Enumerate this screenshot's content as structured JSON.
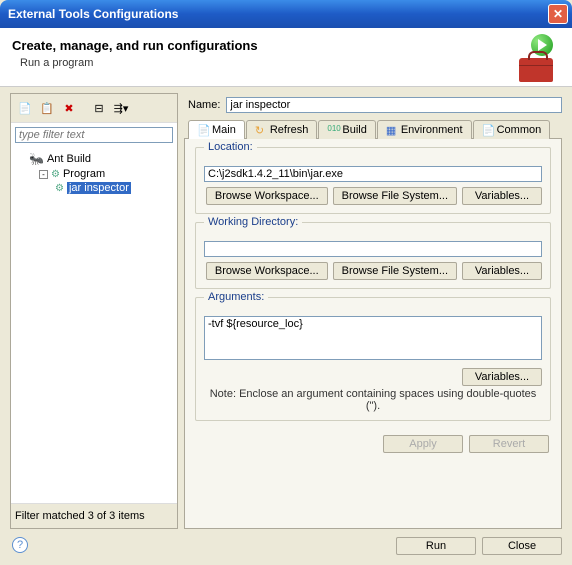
{
  "window": {
    "title": "External Tools Configurations"
  },
  "header": {
    "title": "Create, manage, and run configurations",
    "subtitle": "Run a program"
  },
  "toolbar": {
    "new_tip": "New",
    "duplicate_tip": "Duplicate",
    "delete_tip": "Delete",
    "collapse_tip": "Collapse All",
    "filter_tip": "Filter"
  },
  "filter": {
    "placeholder": "type filter text"
  },
  "tree": {
    "ant": "Ant Build",
    "program": "Program",
    "jar": "jar inspector"
  },
  "filter_status": "Filter matched 3 of 3 items",
  "name_label": "Name:",
  "name_value": "jar inspector",
  "tabs": {
    "main": "Main",
    "refresh": "Refresh",
    "build": "Build",
    "environment": "Environment",
    "common": "Common"
  },
  "groups": {
    "location_title": "Location:",
    "location_value": "C:\\j2sdk1.4.2_11\\bin\\jar.exe",
    "workdir_title": "Working Directory:",
    "workdir_value": "",
    "args_title": "Arguments:",
    "args_value": "-tvf ${resource_loc}",
    "note": "Note: Enclose an argument containing spaces using double-quotes (\")."
  },
  "buttons": {
    "browse_workspace": "Browse Workspace...",
    "browse_filesystem": "Browse File System...",
    "variables": "Variables...",
    "apply": "Apply",
    "revert": "Revert",
    "run": "Run",
    "close": "Close"
  }
}
